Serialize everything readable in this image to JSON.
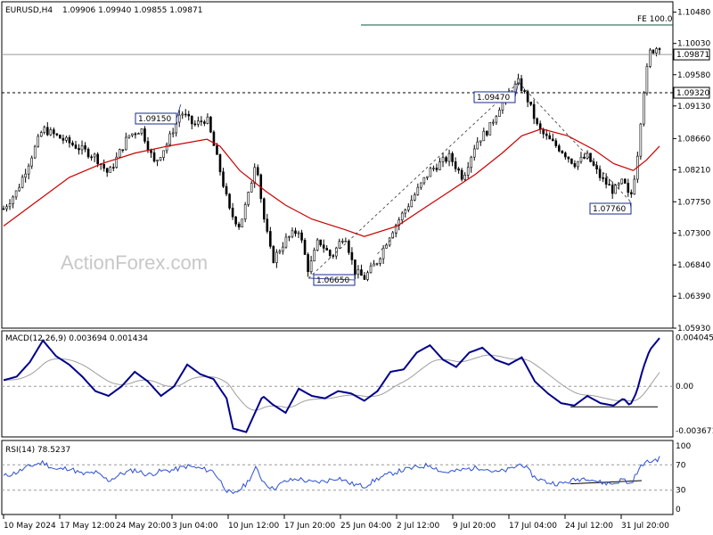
{
  "header": {
    "symbol": "EURUSD,H4",
    "ohlc": "1.09906 1.09940 1.09855 1.09871"
  },
  "watermark": "ActionForex.com",
  "colors": {
    "candles": "#000000",
    "sma": "#cc0000",
    "macd": "#00008b",
    "signal": "#9e9e9e",
    "rsi": "#2b4fd6",
    "fe_line": "#0b5a3b"
  },
  "chart_data": [
    {
      "type": "candlestick",
      "title": "EURUSD,H4",
      "ylim": [
        1.0593,
        1.1063
      ],
      "y_ticks": [
        "1.10480",
        "1.10030",
        "1.09580",
        "1.09130",
        "1.08660",
        "1.08210",
        "1.07750",
        "1.07300",
        "1.06840",
        "1.06390",
        "1.05930"
      ],
      "current_price": "1.09871",
      "horizontal_level": "1.09320",
      "fe_label": "FE 100.0",
      "annotations": [
        {
          "label": "1.09150",
          "x": 0.27,
          "y": 1.0915
        },
        {
          "label": "1.06650",
          "x": 0.465,
          "y": 1.0665
        },
        {
          "label": "1.09470",
          "x": 0.785,
          "y": 1.0947
        },
        {
          "label": "1.07760",
          "x": 0.955,
          "y": 1.0776
        }
      ],
      "price_path": [
        [
          0.0,
          1.0765
        ],
        [
          0.02,
          1.079
        ],
        [
          0.06,
          1.088
        ],
        [
          0.1,
          1.086
        ],
        [
          0.14,
          1.084
        ],
        [
          0.16,
          1.0815
        ],
        [
          0.19,
          1.087
        ],
        [
          0.21,
          1.088
        ],
        [
          0.23,
          1.083
        ],
        [
          0.25,
          1.086
        ],
        [
          0.27,
          1.0905
        ],
        [
          0.29,
          1.0885
        ],
        [
          0.31,
          1.0895
        ],
        [
          0.33,
          1.082
        ],
        [
          0.345,
          1.076
        ],
        [
          0.36,
          1.074
        ],
        [
          0.375,
          1.079
        ],
        [
          0.385,
          1.084
        ],
        [
          0.395,
          1.076
        ],
        [
          0.41,
          1.069
        ],
        [
          0.43,
          1.072
        ],
        [
          0.45,
          1.0735
        ],
        [
          0.465,
          1.0675
        ],
        [
          0.48,
          1.072
        ],
        [
          0.5,
          1.0695
        ],
        [
          0.52,
          1.073
        ],
        [
          0.535,
          1.0675
        ],
        [
          0.55,
          1.0665
        ],
        [
          0.57,
          1.069
        ],
        [
          0.59,
          1.073
        ],
        [
          0.61,
          1.076
        ],
        [
          0.63,
          1.079
        ],
        [
          0.65,
          1.082
        ],
        [
          0.68,
          1.084
        ],
        [
          0.7,
          1.081
        ],
        [
          0.72,
          1.086
        ],
        [
          0.74,
          1.088
        ],
        [
          0.76,
          1.092
        ],
        [
          0.785,
          1.0947
        ],
        [
          0.8,
          1.092
        ],
        [
          0.815,
          1.088
        ],
        [
          0.83,
          1.0865
        ],
        [
          0.85,
          1.085
        ],
        [
          0.87,
          1.083
        ],
        [
          0.89,
          1.084
        ],
        [
          0.91,
          1.081
        ],
        [
          0.93,
          1.079
        ],
        [
          0.945,
          1.0805
        ],
        [
          0.955,
          1.0776
        ],
        [
          0.965,
          1.083
        ],
        [
          0.975,
          1.093
        ],
        [
          0.985,
          1.099
        ],
        [
          1.0,
          1.1
        ]
      ],
      "sma_path": [
        [
          0.0,
          1.074
        ],
        [
          0.05,
          1.0775
        ],
        [
          0.1,
          1.081
        ],
        [
          0.15,
          1.083
        ],
        [
          0.2,
          1.0845
        ],
        [
          0.25,
          1.0855
        ],
        [
          0.31,
          1.0865
        ],
        [
          0.33,
          1.0855
        ],
        [
          0.36,
          1.082
        ],
        [
          0.4,
          1.079
        ],
        [
          0.43,
          1.077
        ],
        [
          0.47,
          1.075
        ],
        [
          0.52,
          1.0735
        ],
        [
          0.55,
          1.0725
        ],
        [
          0.6,
          1.074
        ],
        [
          0.64,
          1.0765
        ],
        [
          0.68,
          1.079
        ],
        [
          0.72,
          1.0815
        ],
        [
          0.76,
          1.0845
        ],
        [
          0.79,
          1.087
        ],
        [
          0.82,
          1.088
        ],
        [
          0.86,
          1.087
        ],
        [
          0.9,
          1.085
        ],
        [
          0.93,
          1.083
        ],
        [
          0.96,
          1.082
        ],
        [
          0.98,
          1.0835
        ],
        [
          1.0,
          1.0855
        ]
      ]
    },
    {
      "type": "line",
      "title": "MACD(12,26,9) 0.003694 0.001434",
      "ylim": [
        -0.0042,
        0.0046
      ],
      "y_ticks": [
        "0.004045",
        "0.00",
        "-0.003671"
      ],
      "macd_path": [
        [
          0.0,
          0.0005
        ],
        [
          0.02,
          0.0008
        ],
        [
          0.04,
          0.002
        ],
        [
          0.06,
          0.0038
        ],
        [
          0.08,
          0.0025
        ],
        [
          0.1,
          0.0018
        ],
        [
          0.12,
          0.0008
        ],
        [
          0.14,
          -0.0004
        ],
        [
          0.16,
          -0.0008
        ],
        [
          0.18,
          0.0
        ],
        [
          0.2,
          0.0012
        ],
        [
          0.22,
          0.0004
        ],
        [
          0.24,
          -0.0008
        ],
        [
          0.26,
          0.0
        ],
        [
          0.28,
          0.0018
        ],
        [
          0.3,
          0.001
        ],
        [
          0.32,
          0.0006
        ],
        [
          0.34,
          -0.001
        ],
        [
          0.35,
          -0.0035
        ],
        [
          0.37,
          -0.0038
        ],
        [
          0.385,
          -0.002
        ],
        [
          0.395,
          -0.0008
        ],
        [
          0.41,
          -0.0015
        ],
        [
          0.43,
          -0.0022
        ],
        [
          0.45,
          -0.0002
        ],
        [
          0.47,
          -0.0008
        ],
        [
          0.49,
          -0.001
        ],
        [
          0.51,
          -0.0004
        ],
        [
          0.53,
          -0.0006
        ],
        [
          0.55,
          -0.0012
        ],
        [
          0.57,
          -0.0004
        ],
        [
          0.59,
          0.0012
        ],
        [
          0.61,
          0.0014
        ],
        [
          0.63,
          0.0028
        ],
        [
          0.65,
          0.0034
        ],
        [
          0.67,
          0.0022
        ],
        [
          0.69,
          0.0016
        ],
        [
          0.71,
          0.0028
        ],
        [
          0.73,
          0.0032
        ],
        [
          0.75,
          0.0022
        ],
        [
          0.77,
          0.0018
        ],
        [
          0.79,
          0.0024
        ],
        [
          0.81,
          0.0004
        ],
        [
          0.83,
          -0.0006
        ],
        [
          0.85,
          -0.0014
        ],
        [
          0.87,
          -0.0016
        ],
        [
          0.89,
          -0.0008
        ],
        [
          0.91,
          -0.0014
        ],
        [
          0.93,
          -0.0016
        ],
        [
          0.945,
          -0.001
        ],
        [
          0.955,
          -0.0016
        ],
        [
          0.965,
          -0.0005
        ],
        [
          0.975,
          0.0015
        ],
        [
          0.985,
          0.003
        ],
        [
          1.0,
          0.004
        ]
      ]
    },
    {
      "type": "line",
      "title": "RSI(14) 78.5237",
      "ylim": [
        0,
        100
      ],
      "y_ticks": [
        "100",
        "70",
        "30",
        "0"
      ],
      "rsi_path": [
        [
          0.0,
          52
        ],
        [
          0.02,
          58
        ],
        [
          0.04,
          68
        ],
        [
          0.06,
          74
        ],
        [
          0.08,
          62
        ],
        [
          0.1,
          65
        ],
        [
          0.12,
          55
        ],
        [
          0.14,
          58
        ],
        [
          0.16,
          45
        ],
        [
          0.18,
          56
        ],
        [
          0.2,
          62
        ],
        [
          0.22,
          54
        ],
        [
          0.24,
          60
        ],
        [
          0.26,
          62
        ],
        [
          0.28,
          68
        ],
        [
          0.3,
          64
        ],
        [
          0.32,
          60
        ],
        [
          0.34,
          30
        ],
        [
          0.35,
          22
        ],
        [
          0.37,
          40
        ],
        [
          0.385,
          65
        ],
        [
          0.395,
          45
        ],
        [
          0.41,
          32
        ],
        [
          0.43,
          44
        ],
        [
          0.45,
          48
        ],
        [
          0.47,
          42
        ],
        [
          0.49,
          44
        ],
        [
          0.51,
          50
        ],
        [
          0.53,
          40
        ],
        [
          0.55,
          36
        ],
        [
          0.57,
          48
        ],
        [
          0.59,
          56
        ],
        [
          0.61,
          62
        ],
        [
          0.63,
          66
        ],
        [
          0.65,
          70
        ],
        [
          0.67,
          58
        ],
        [
          0.69,
          60
        ],
        [
          0.71,
          64
        ],
        [
          0.73,
          66
        ],
        [
          0.75,
          58
        ],
        [
          0.77,
          62
        ],
        [
          0.79,
          72
        ],
        [
          0.81,
          50
        ],
        [
          0.83,
          42
        ],
        [
          0.85,
          40
        ],
        [
          0.87,
          46
        ],
        [
          0.89,
          50
        ],
        [
          0.91,
          42
        ],
        [
          0.93,
          40
        ],
        [
          0.945,
          48
        ],
        [
          0.955,
          38
        ],
        [
          0.965,
          56
        ],
        [
          0.975,
          72
        ],
        [
          0.985,
          75
        ],
        [
          1.0,
          80
        ]
      ]
    }
  ],
  "x_axis": {
    "labels": [
      "10 May 2024",
      "17 May 12:00",
      "24 May 20:00",
      "3 Jun 04:00",
      "10 Jun 12:00",
      "17 Jun 20:00",
      "25 Jun 04:00",
      "2 Jul 12:00",
      "9 Jul 20:00",
      "17 Jul 04:00",
      "24 Jul 12:00",
      "31 Jul 20:00"
    ]
  }
}
